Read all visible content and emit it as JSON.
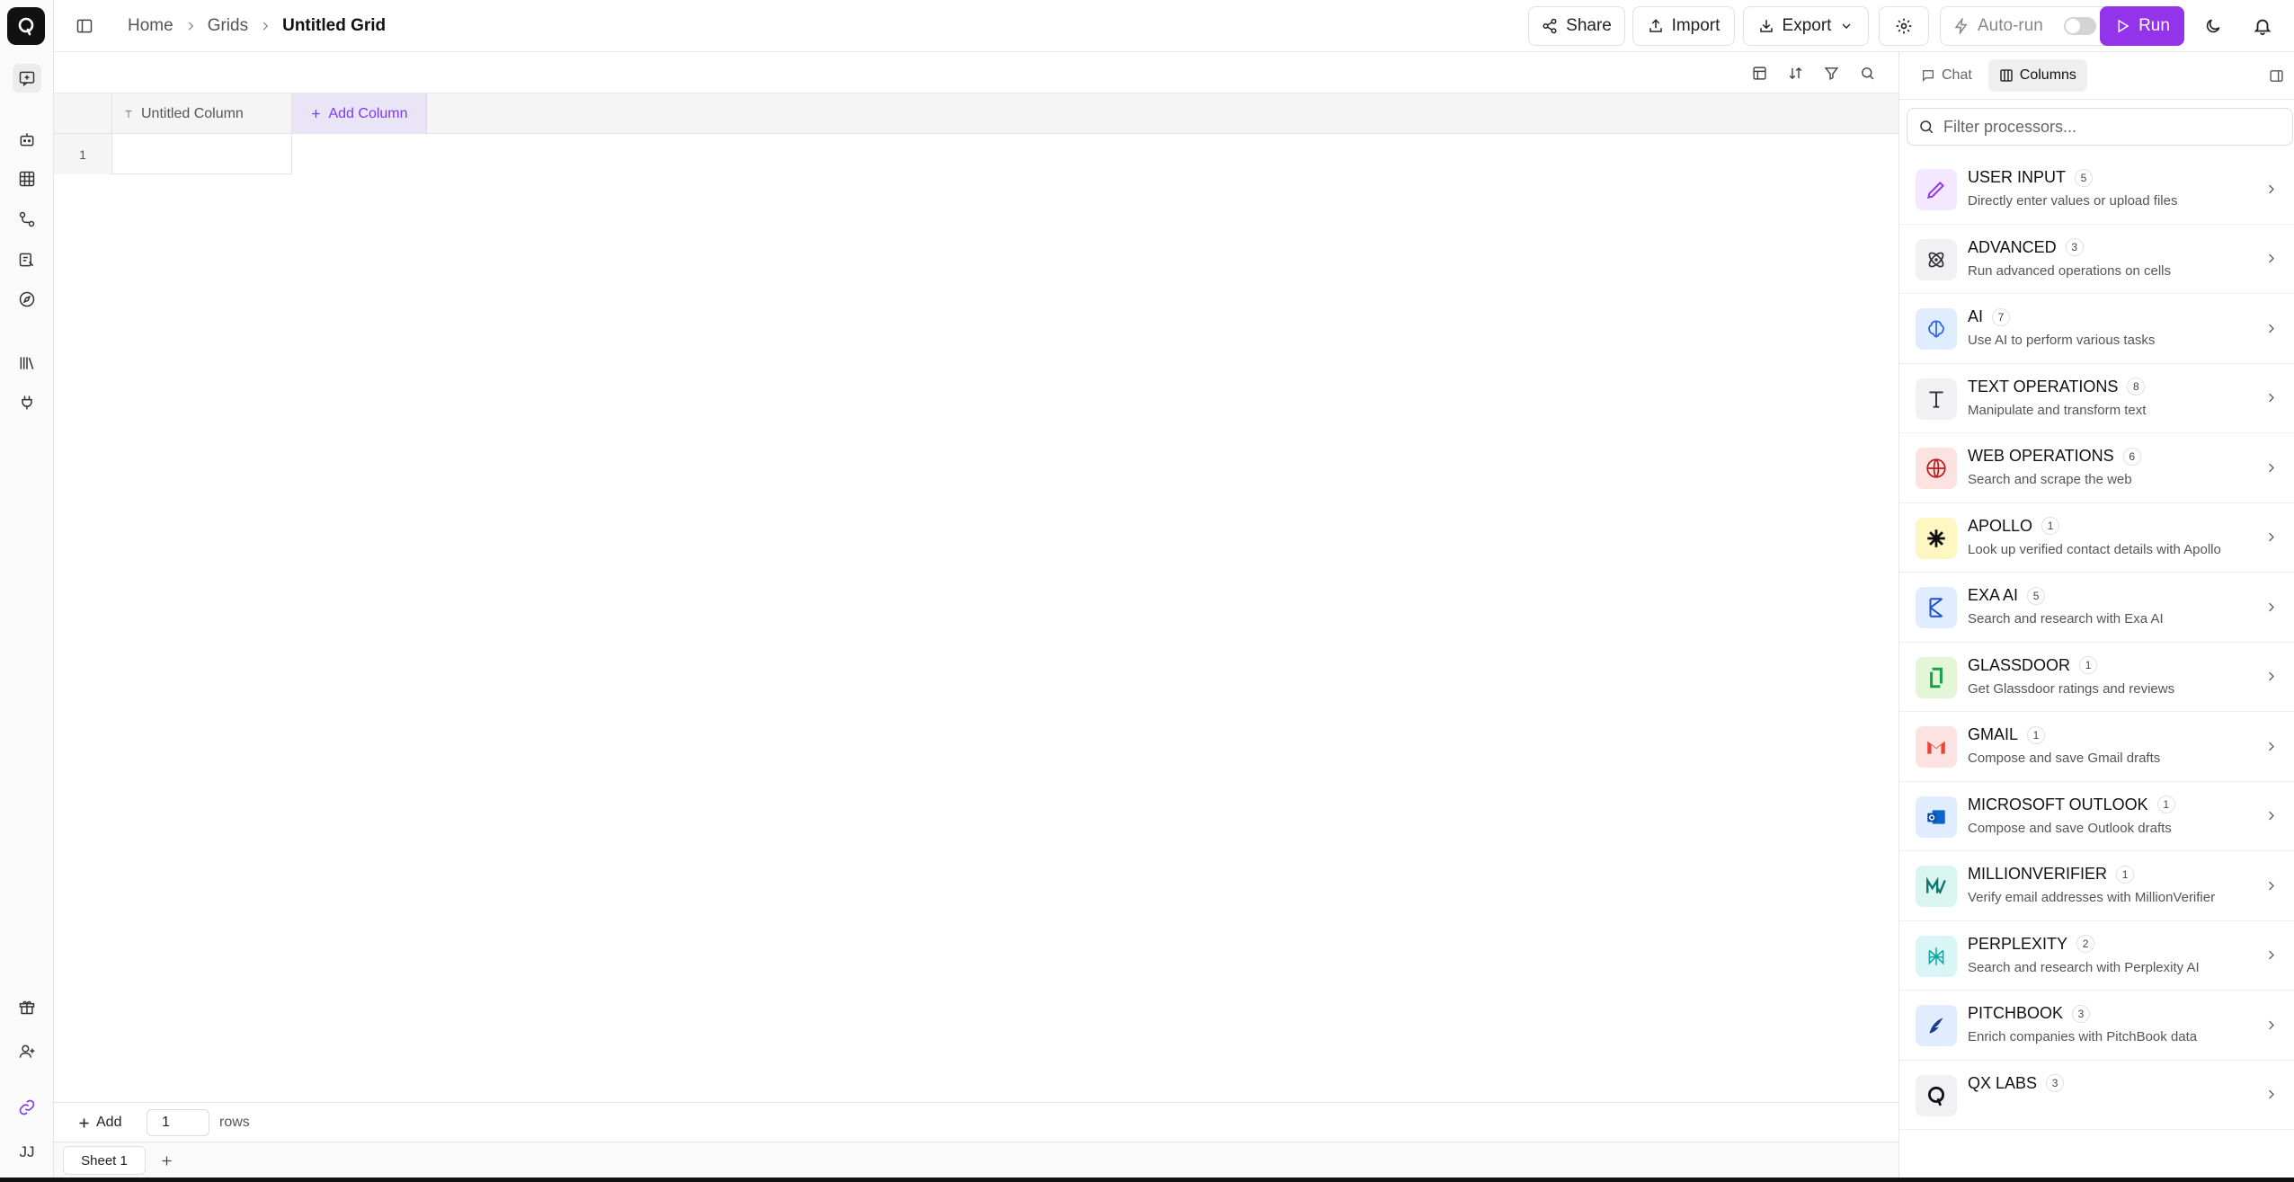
{
  "header": {
    "breadcrumb": [
      "Home",
      "Grids",
      "Untitled Grid"
    ],
    "buttons": {
      "share": "Share",
      "import": "Import",
      "export": "Export",
      "autorun": "Auto-run",
      "run": "Run"
    },
    "autorun_enabled": false
  },
  "grid": {
    "columns": [
      "Untitled Column"
    ],
    "add_column_label": "Add Column",
    "rows": [
      {
        "number": "1",
        "cells": [
          ""
        ]
      }
    ]
  },
  "footer": {
    "add_label": "Add",
    "row_count_value": "1",
    "rows_label": "rows",
    "sheets": [
      "Sheet 1"
    ]
  },
  "rail": {
    "avatar_initials": "JJ"
  },
  "panel": {
    "tabs": [
      "Chat",
      "Columns"
    ],
    "active_tab": "Columns",
    "filter_placeholder": "Filter processors...",
    "processors": [
      {
        "name": "USER INPUT",
        "count": "5",
        "desc": "Directly enter values or upload files",
        "icon": "pencil-icon",
        "bg": "#f3e8ff",
        "fg": "#9333ea"
      },
      {
        "name": "ADVANCED",
        "count": "3",
        "desc": "Run advanced operations on cells",
        "icon": "atom-icon",
        "bg": "#f1f1f3",
        "fg": "#333333"
      },
      {
        "name": "AI",
        "count": "7",
        "desc": "Use AI to perform various tasks",
        "icon": "brain-icon",
        "bg": "#e0ecff",
        "fg": "#2563eb"
      },
      {
        "name": "TEXT OPERATIONS",
        "count": "8",
        "desc": "Manipulate and transform text",
        "icon": "text-icon",
        "bg": "#f1f1f3",
        "fg": "#333333"
      },
      {
        "name": "WEB OPERATIONS",
        "count": "6",
        "desc": "Search and scrape the web",
        "icon": "globe-icon",
        "bg": "#fde2e2",
        "fg": "#b91c1c"
      },
      {
        "name": "APOLLO",
        "count": "1",
        "desc": "Look up verified contact details with Apollo",
        "icon": "apollo-icon",
        "bg": "#fff7c2",
        "fg": "#111111"
      },
      {
        "name": "EXA AI",
        "count": "5",
        "desc": "Search and research with Exa AI",
        "icon": "exa-icon",
        "bg": "#e0ecff",
        "fg": "#1d4ed8"
      },
      {
        "name": "GLASSDOOR",
        "count": "1",
        "desc": "Get Glassdoor ratings and reviews",
        "icon": "glassdoor-icon",
        "bg": "#e3f6d7",
        "fg": "#16a34a"
      },
      {
        "name": "GMAIL",
        "count": "1",
        "desc": "Compose and save Gmail drafts",
        "icon": "gmail-icon",
        "bg": "#fde2e2",
        "fg": "#ea4335"
      },
      {
        "name": "MICROSOFT OUTLOOK",
        "count": "1",
        "desc": "Compose and save Outlook drafts",
        "icon": "outlook-icon",
        "bg": "#e0ecff",
        "fg": "#0a64c9"
      },
      {
        "name": "MILLIONVERIFIER",
        "count": "1",
        "desc": "Verify email addresses with MillionVerifier",
        "icon": "millionverifier-icon",
        "bg": "#d9f5ef",
        "fg": "#0f766e"
      },
      {
        "name": "PERPLEXITY",
        "count": "2",
        "desc": "Search and research with Perplexity AI",
        "icon": "perplexity-icon",
        "bg": "#d9f5f5",
        "fg": "#0ea5a5"
      },
      {
        "name": "PITCHBOOK",
        "count": "3",
        "desc": "Enrich companies with PitchBook data",
        "icon": "pitchbook-icon",
        "bg": "#e0ecff",
        "fg": "#1e3a8a"
      },
      {
        "name": "QX LABS",
        "count": "3",
        "desc": "",
        "icon": "qx-labs-icon",
        "bg": "#f1f1f3",
        "fg": "#111111"
      }
    ]
  }
}
